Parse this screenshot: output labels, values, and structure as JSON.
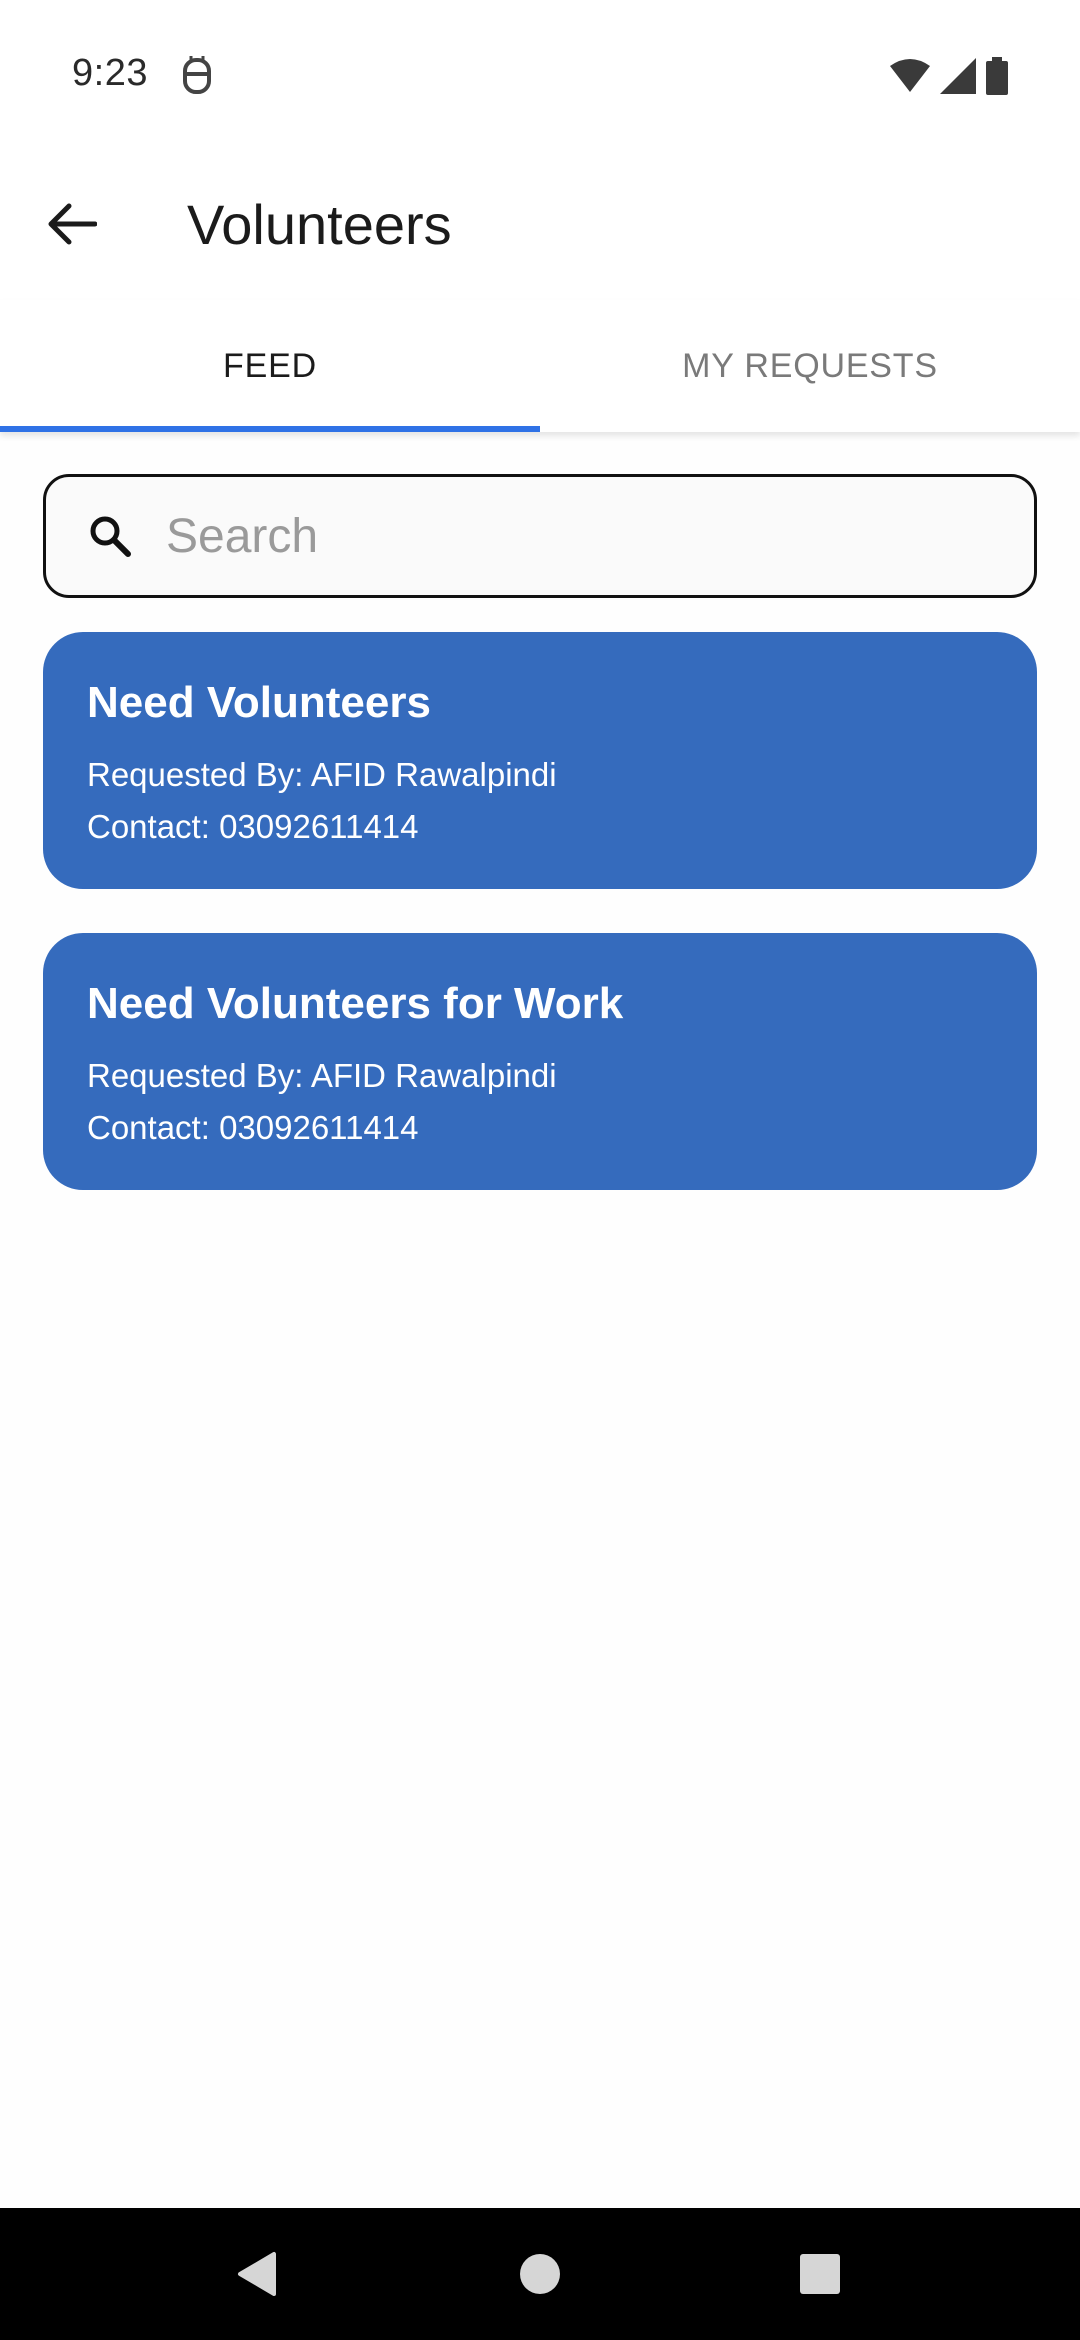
{
  "status_bar": {
    "time": "9:23",
    "icons": [
      "notification-app-icon",
      "wifi-icon",
      "cellular-signal-icon",
      "battery-icon"
    ]
  },
  "app_bar": {
    "title": "Volunteers",
    "back_icon": "arrow-back-icon"
  },
  "tabs": [
    {
      "label": "FEED",
      "active": true
    },
    {
      "label": "MY REQUESTS",
      "active": false
    }
  ],
  "search": {
    "placeholder": "Search",
    "value": "",
    "icon": "search-icon"
  },
  "feed": [
    {
      "title": "Need Volunteers",
      "requested_by": "Requested By: AFID Rawalpindi",
      "contact": "Contact: 03092611414"
    },
    {
      "title": "Need Volunteers for Work",
      "requested_by": "Requested By: AFID Rawalpindi",
      "contact": "Contact: 03092611414"
    }
  ],
  "colors": {
    "card_background": "#356bbd",
    "tab_indicator": "#2f72e6",
    "nav_bar": "#000000"
  },
  "nav_bar": {
    "icons": [
      "nav-back-icon",
      "nav-home-icon",
      "nav-recents-icon"
    ]
  }
}
